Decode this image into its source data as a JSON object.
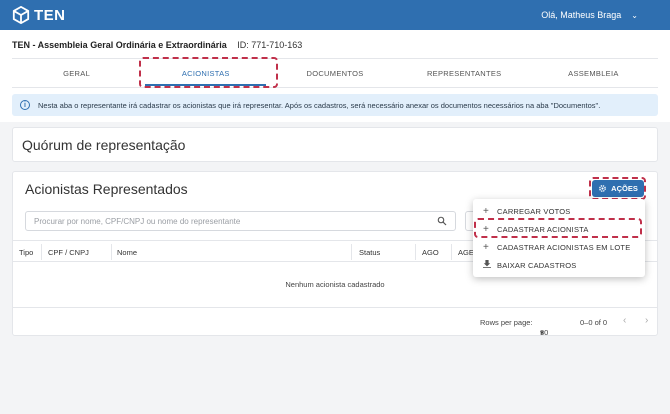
{
  "app": {
    "logo_text": "TEN"
  },
  "user": {
    "greeting": "Olá, Matheus Braga"
  },
  "page": {
    "title": "TEN - Assembleia Geral Ordinária e Extraordinária",
    "id_text": "ID: 771-710-163"
  },
  "tabs": [
    {
      "label": "GERAL"
    },
    {
      "label": "ACIONISTAS",
      "active": true
    },
    {
      "label": "DOCUMENTOS"
    },
    {
      "label": "REPRESENTANTES"
    },
    {
      "label": "ASSEMBLEIA"
    }
  ],
  "info_banner": {
    "text": "Nesta aba o representante irá cadastrar os acionistas que irá representar. Após os cadastros, será necessário anexar os documentos necessários na aba \"Documentos\"."
  },
  "quorum_card": {
    "title": "Quórum de representação"
  },
  "acionistas_card": {
    "title": "Acionistas Representados",
    "actions_label": "AÇÕES",
    "search_placeholder": "Procurar por nome, CPF/CNPJ ou nome do representante",
    "search_value": "",
    "columns": [
      "Tipo",
      "CPF / CNPJ",
      "Nome",
      "Status",
      "AGO",
      "AGE"
    ],
    "empty_text": "Nenhum acionista cadastrado",
    "rows_per_page_label": "Rows per page:",
    "rows_per_page_value": "30",
    "range_text": "0–0 of 0"
  },
  "actions_menu": [
    {
      "label": "CARREGAR VOTOS",
      "icon": "plus-icon"
    },
    {
      "label": "CADASTRAR ACIONISTA",
      "icon": "plus-icon"
    },
    {
      "label": "CADASTRAR ACIONISTAS EM LOTE",
      "icon": "plus-icon"
    },
    {
      "label": "BAIXAR CADASTROS",
      "icon": "download-icon"
    }
  ],
  "colors": {
    "primary": "#2f6fb0",
    "highlight": "#c0304a",
    "info_bg": "#e2effb"
  }
}
